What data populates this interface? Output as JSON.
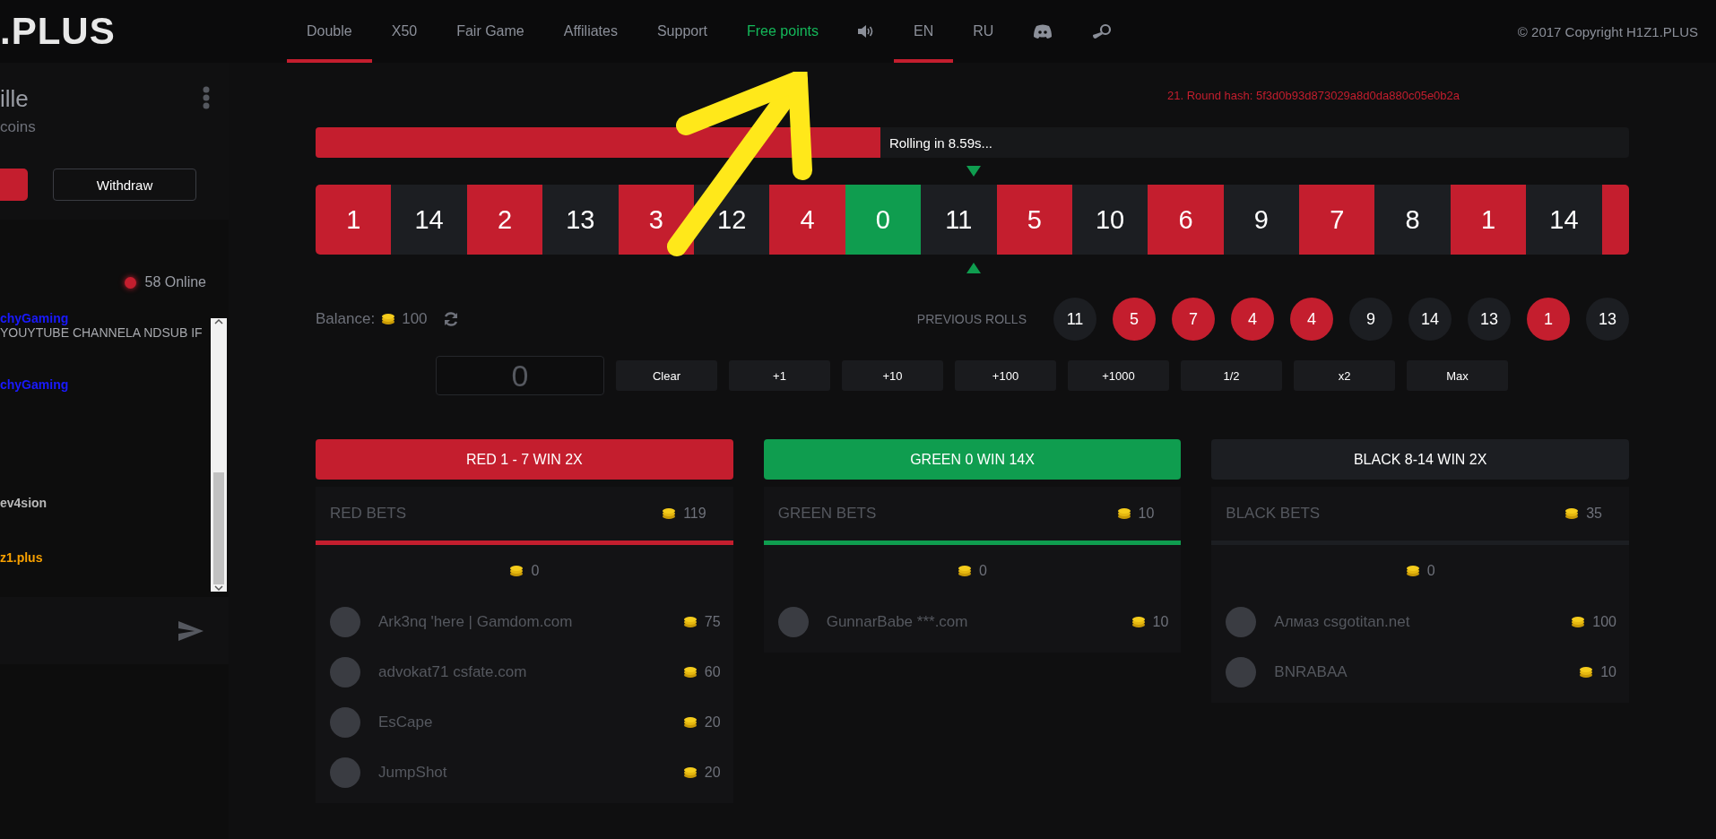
{
  "logo": {
    "text": ".PLUS"
  },
  "nav": [
    {
      "label": "Double",
      "selected": true
    },
    {
      "label": "X50",
      "selected": false
    },
    {
      "label": "Fair Game",
      "selected": false
    },
    {
      "label": "Affiliates",
      "selected": false
    },
    {
      "label": "Support",
      "selected": false
    },
    {
      "label": "Free points",
      "selected": false,
      "kind": "highlight"
    }
  ],
  "languages": [
    {
      "label": "EN",
      "selected": true
    },
    {
      "label": "RU",
      "selected": false
    }
  ],
  "copyright": "© 2017 Copyright H1Z1.PLUS",
  "user": {
    "name": "ille",
    "balance": "coins",
    "withdraw": "Withdraw"
  },
  "chat": {
    "online": "58 Online",
    "messages": [
      {
        "kind": "name",
        "text": "chyGaming",
        "color": "#1a1aff"
      },
      {
        "kind": "message",
        "text": "YOUYTUBE CHANNELA NDSUB IF"
      },
      {
        "kind": "name",
        "text": "chyGaming",
        "color": "#1a1aff"
      },
      {
        "kind": "name",
        "text": "ev4sion",
        "color": "#b8b8b8"
      },
      {
        "kind": "name",
        "text": "z1.plus",
        "color": "#f7a000"
      }
    ]
  },
  "round_hash": "21. Round hash: 5f3d0b93d873029a8d0da880c05e0b2a",
  "progress": {
    "level": 0.43,
    "label": "Rolling in 8.59s..."
  },
  "wheel": [
    {
      "number": "1",
      "kind": "red"
    },
    {
      "number": "14",
      "kind": "black"
    },
    {
      "number": "2",
      "kind": "red"
    },
    {
      "number": "13",
      "kind": "black"
    },
    {
      "number": "3",
      "kind": "red"
    },
    {
      "number": "12",
      "kind": "black"
    },
    {
      "number": "4",
      "kind": "red"
    },
    {
      "number": "0",
      "kind": "green"
    },
    {
      "number": "11",
      "kind": "black"
    },
    {
      "number": "5",
      "kind": "red"
    },
    {
      "number": "10",
      "kind": "black"
    },
    {
      "number": "6",
      "kind": "red"
    },
    {
      "number": "9",
      "kind": "black"
    },
    {
      "number": "7",
      "kind": "red"
    },
    {
      "number": "8",
      "kind": "black"
    },
    {
      "number": "1",
      "kind": "red"
    },
    {
      "number": "14",
      "kind": "black"
    }
  ],
  "balance": {
    "label": "Balance:",
    "amount": "100"
  },
  "previous_rolls": {
    "label": "PREVIOUS ROLLS",
    "rolls": [
      {
        "number": "11",
        "kind": "black"
      },
      {
        "number": "5",
        "kind": "red"
      },
      {
        "number": "7",
        "kind": "red"
      },
      {
        "number": "4",
        "kind": "red"
      },
      {
        "number": "4",
        "kind": "red"
      },
      {
        "number": "9",
        "kind": "black"
      },
      {
        "number": "14",
        "kind": "black"
      },
      {
        "number": "13",
        "kind": "black"
      },
      {
        "number": "1",
        "kind": "red"
      },
      {
        "number": "13",
        "kind": "black"
      }
    ]
  },
  "bet_input": {
    "value": "0"
  },
  "bet_buttons": [
    "Clear",
    "+1",
    "+10",
    "+100",
    "+1000",
    "1/2",
    "x2",
    "Max"
  ],
  "bet_columns": [
    {
      "kind": "red",
      "button": "RED 1 - 7 WIN 2X",
      "title": "RED BETS",
      "total": "119",
      "pot": "0",
      "bets": [
        {
          "name": "Ark3nq 'here | Gamdom.com",
          "amount": "75"
        },
        {
          "name": "advokat71 csfate.com",
          "amount": "60"
        },
        {
          "name": "EsCape",
          "amount": "20"
        },
        {
          "name": "JumpShot",
          "amount": "20"
        }
      ]
    },
    {
      "kind": "green",
      "button": "GREEN 0 WIN 14X",
      "title": "GREEN BETS",
      "total": "10",
      "pot": "0",
      "bets": [
        {
          "name": "GunnarBabe ***.com",
          "amount": "10"
        }
      ]
    },
    {
      "kind": "black",
      "button": "BLACK 8-14 WIN 2X",
      "title": "BLACK BETS",
      "total": "35",
      "pot": "0",
      "bets": [
        {
          "name": "Алмаз csgotitan.net",
          "amount": "100"
        },
        {
          "name": "BNRABAA",
          "amount": "10"
        }
      ]
    }
  ]
}
